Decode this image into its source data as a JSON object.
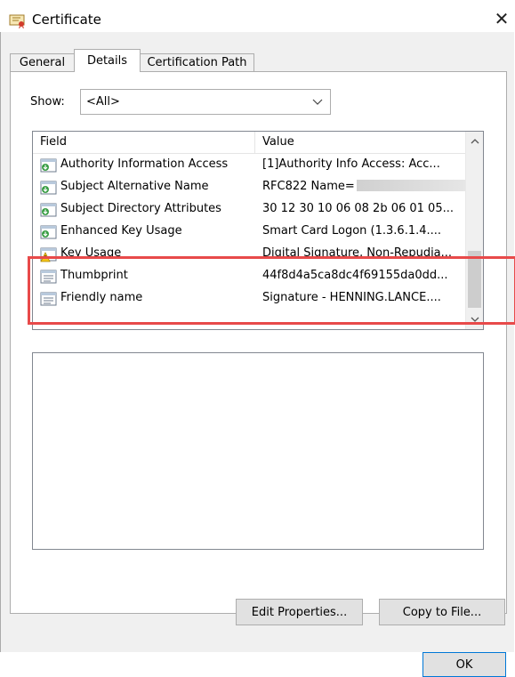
{
  "window": {
    "title": "Certificate",
    "close_glyph": "✕"
  },
  "tabs": [
    {
      "label": "General",
      "active": false
    },
    {
      "label": "Details",
      "active": true
    },
    {
      "label": "Certification Path",
      "active": false
    }
  ],
  "show": {
    "label": "Show:",
    "value": "<All>"
  },
  "list": {
    "headers": {
      "field": "Field",
      "value": "Value"
    },
    "rows": [
      {
        "field": "Authority Information Access",
        "value": "[1]Authority Info Access: Acc...",
        "icon": "cert-extension-icon"
      },
      {
        "field": "Subject Alternative Name",
        "value": "RFC822 Name=",
        "icon": "cert-extension-icon"
      },
      {
        "field": "Subject Directory Attributes",
        "value": "30 12 30 10 06 08 2b 06 01 05...",
        "icon": "cert-extension-icon"
      },
      {
        "field": "Enhanced Key Usage",
        "value": "Smart Card Logon (1.3.6.1.4....",
        "icon": "cert-extension-icon"
      },
      {
        "field": "Key Usage",
        "value": "Digital Signature, Non-Repudia...",
        "icon": "cert-warning-icon"
      },
      {
        "field": "Thumbprint",
        "value": "44f8d4a5ca8dc4f69155da0dd...",
        "icon": "cert-property-icon"
      },
      {
        "field": "Friendly name",
        "value": "Signature - HENNING.LANCE....",
        "icon": "cert-property-icon"
      }
    ]
  },
  "buttons": {
    "edit_properties": "Edit Properties...",
    "copy_to_file": "Copy to File...",
    "ok": "OK"
  },
  "colors": {
    "highlight": "#e84a4a",
    "dialog_bg": "#f0f0f0",
    "ok_border": "#0078d7"
  }
}
